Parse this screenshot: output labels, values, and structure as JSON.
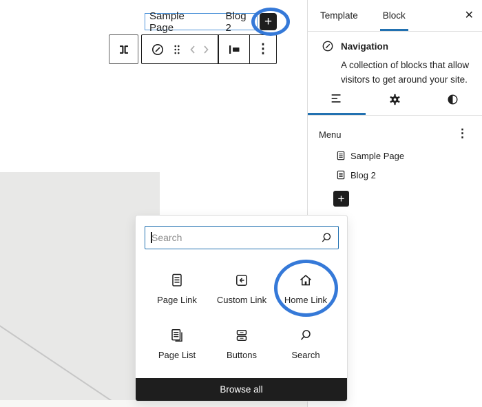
{
  "colors": {
    "accent_blue": "#2271b1",
    "annotation_blue": "#3579d8",
    "selection_blue": "#4f94d9",
    "dark": "#1e1e1e",
    "placeholder_gray": "#e8e8e7"
  },
  "icons": {
    "plus": "+",
    "close": "✕",
    "kebab": "⋮",
    "parent_selector": "][",
    "navigation": "compass-circle",
    "drag_handle": "six-dots",
    "chevron_left": "‹",
    "chevron_right": "›",
    "justify": "justify-left",
    "list_view": "three-lines",
    "settings": "gear",
    "styles": "half-circle",
    "search": "magnifier"
  },
  "nav_block": {
    "items": [
      {
        "label": "Sample Page"
      },
      {
        "label": "Blog 2"
      }
    ],
    "add_label": "+"
  },
  "sidebar": {
    "tabs": [
      {
        "label": "Template",
        "active": false
      },
      {
        "label": "Block",
        "active": true
      }
    ],
    "close_label": "✕",
    "block_card": {
      "title": "Navigation",
      "description": "A collection of blocks that allow visitors to get around your site."
    },
    "inspector_tabs": [
      {
        "name": "list-view",
        "active": true
      },
      {
        "name": "settings",
        "active": false
      },
      {
        "name": "styles",
        "active": false
      }
    ],
    "menu": {
      "heading": "Menu",
      "items": [
        {
          "label": "Sample Page"
        },
        {
          "label": "Blog 2"
        }
      ],
      "add_label": "+",
      "options_label": "⋮"
    }
  },
  "inserter": {
    "search": {
      "placeholder": "Search",
      "value": ""
    },
    "blocks": [
      {
        "label": "Page Link",
        "icon": "page-link-icon",
        "annotated": false
      },
      {
        "label": "Custom Link",
        "icon": "custom-link-icon",
        "annotated": false
      },
      {
        "label": "Home Link",
        "icon": "home-link-icon",
        "annotated": true
      },
      {
        "label": "Page List",
        "icon": "page-list-icon",
        "annotated": false
      },
      {
        "label": "Buttons",
        "icon": "buttons-icon",
        "annotated": false
      },
      {
        "label": "Search",
        "icon": "search-icon",
        "annotated": false
      }
    ],
    "browse_all_label": "Browse all"
  }
}
